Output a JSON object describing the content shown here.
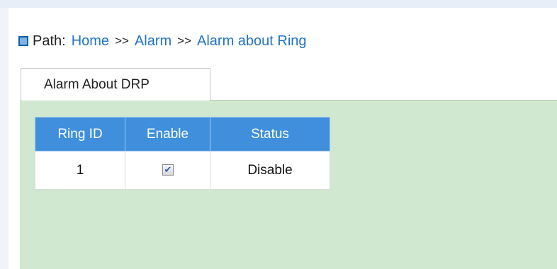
{
  "breadcrumb": {
    "label": "Path:",
    "items": [
      "Home",
      "Alarm",
      "Alarm about Ring"
    ],
    "separator": ">>"
  },
  "tabs": [
    {
      "label": "Alarm About DRP",
      "active": true
    }
  ],
  "table": {
    "columns": [
      "Ring ID",
      "Enable",
      "Status"
    ],
    "rows": [
      {
        "ring_id": "1",
        "enable": true,
        "enable_mark": "✔",
        "status": "Disable"
      }
    ]
  },
  "colors": {
    "header_bg": "#3f8fdc",
    "panel_bg": "#cfe8cf",
    "link": "#1e73c8"
  }
}
